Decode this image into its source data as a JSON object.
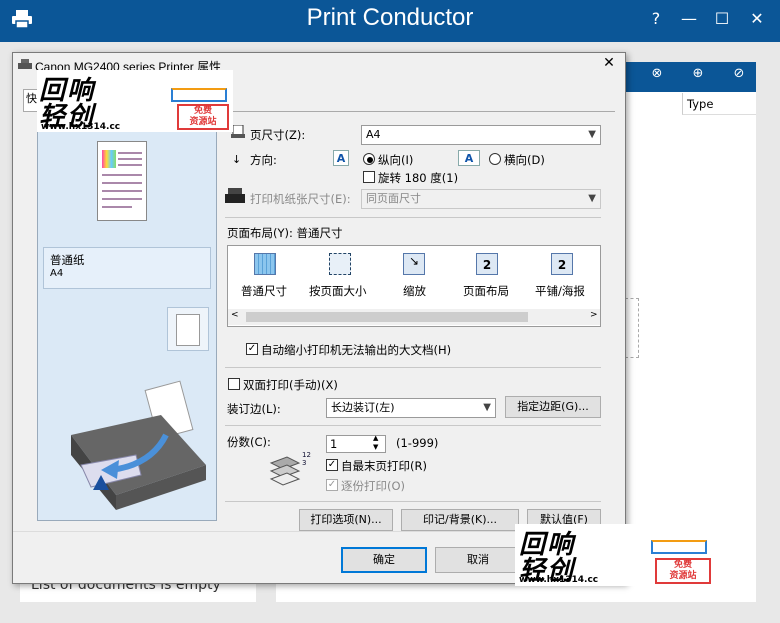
{
  "app": {
    "title": "Print Conductor",
    "help": "?",
    "minimize": "—",
    "maximize": "☐",
    "close": "✕"
  },
  "background": {
    "column_type": "Type",
    "empty_text": "List of documents is empty"
  },
  "dialog": {
    "title": "Canon MG2400 series Printer 属性",
    "close": "✕",
    "tab_first": "快",
    "left_panel": {
      "media_type": "普通纸",
      "paper_size": "A4"
    },
    "page_size": {
      "label": "页尺寸(Z):",
      "value": "A4"
    },
    "orientation": {
      "label": "方向:",
      "portrait": "纵向(I)",
      "landscape": "横向(D)",
      "rotate": "旋转 180 度(1)"
    },
    "printer_paper_size": {
      "label": "打印机纸张尺寸(E):",
      "value": "同页面尺寸"
    },
    "page_layout": {
      "label": "页面布局(Y): 普通尺寸",
      "items": [
        "普通尺寸",
        "按页面大小",
        "缩放",
        "页面布局",
        "平铺/海报"
      ],
      "icon_numbers": [
        "",
        "",
        "",
        "2",
        "2"
      ]
    },
    "auto_reduce": "自动缩小打印机无法输出的大文档(H)",
    "duplex": "双面打印(手动)(X)",
    "binding": {
      "label": "装订边(L):",
      "value": "长边装订(左)",
      "margin_button": "指定边距(G)..."
    },
    "copies": {
      "label": "份数(C):",
      "value": "1",
      "range": "(1-999)",
      "last_page_first": "自最末页打印(R)",
      "collate": "逐份打印(O)",
      "collate_icon": "123"
    },
    "buttons": {
      "print_options": "打印选项(N)...",
      "stamp": "印记/背景(K)...",
      "defaults": "默认值(F)",
      "ok": "确定",
      "cancel": "取消"
    }
  },
  "watermark": {
    "line1": "回响",
    "line2": "轻创",
    "url": "www.hx1314.cc",
    "badge1": "免费",
    "badge2": "资源站"
  },
  "colors": {
    "titlebar": "#0b5697",
    "accent": "#0078d7",
    "panel": "#dbe9f6"
  }
}
